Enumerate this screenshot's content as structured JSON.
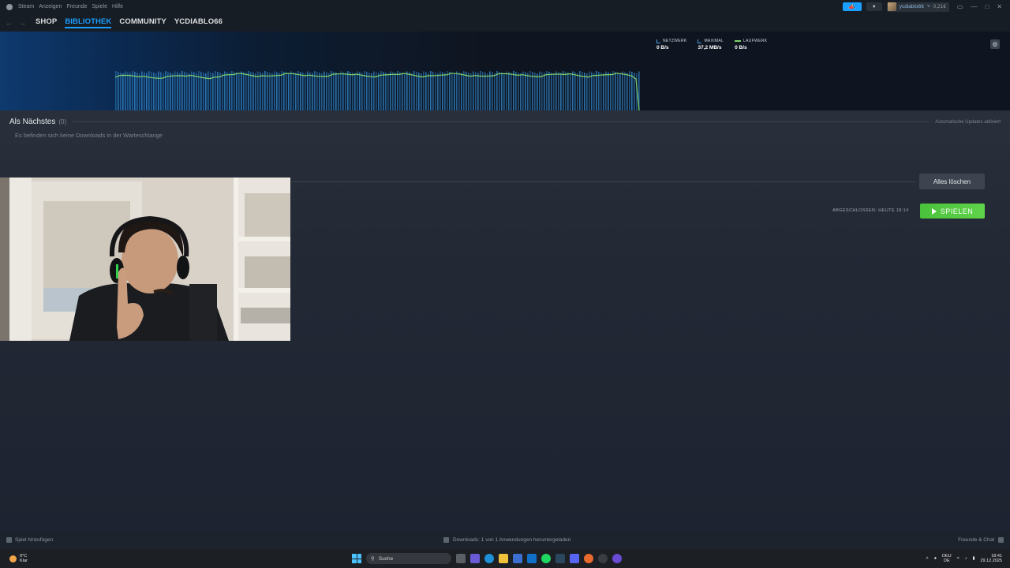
{
  "titlebar": {
    "menu": [
      "Steam",
      "Anzeigen",
      "Freunde",
      "Spiele",
      "Hilfe"
    ],
    "account_name": "ycdiablo66",
    "balance": "0,21€"
  },
  "nav": {
    "links": [
      "SHOP",
      "BIBLIOTHEK",
      "COMMUNITY",
      "YCDIABLO66"
    ],
    "active": "BIBLIOTHEK"
  },
  "stats": [
    {
      "label": "NETZWERK",
      "value": "0 B/s"
    },
    {
      "label": "MAXIMAL",
      "value": "37,2 MB/s"
    },
    {
      "label": "LAUFWERK",
      "value": "0 B/s"
    }
  ],
  "queue": {
    "title": "Als Nächstes",
    "count": "(0)",
    "auto_updates": "Automatische Updates aktiviert",
    "empty_message": "Es befinden sich keine Downloads in der Warteschlange"
  },
  "completed": {
    "clear_label": "Alles löschen",
    "status": "ABGESCHLOSSEN: HEUTE 18:14",
    "play_label": "SPIELEN"
  },
  "bottombar": {
    "add_game": "Spiel hinzufügen",
    "downloads": "Downloads: 1 von 1 Anwendungen heruntergeladen",
    "friends": "Freunde & Chat"
  },
  "taskbar": {
    "temperature": "0°C",
    "weather": "Klar",
    "search_placeholder": "Suche",
    "lang1": "DEU",
    "lang2": "DE",
    "time": "18:41",
    "date": "29.12.2025"
  },
  "colors": {
    "accent": "#1a9fff",
    "play": "#4bc23b",
    "graph_bars": "#2f7fc0",
    "graph_line": "#7fd16a"
  }
}
